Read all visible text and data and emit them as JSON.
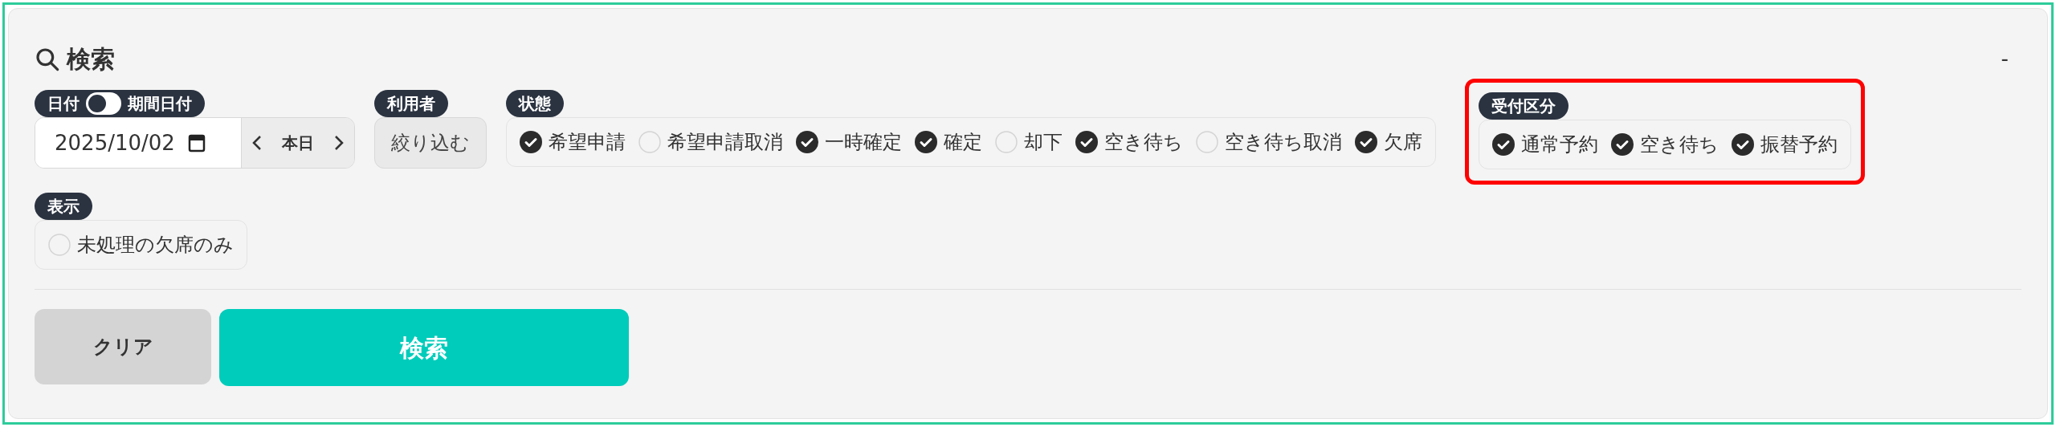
{
  "panel": {
    "title": "検索",
    "collapse": "-"
  },
  "date_filter": {
    "label": "日付",
    "toggle_label": "期間日付",
    "period": false,
    "value": "2025/10/02",
    "today": "本日"
  },
  "user_filter": {
    "label": "利用者",
    "button": "絞り込む"
  },
  "status_filter": {
    "label": "状態",
    "options": [
      {
        "label": "希望申請",
        "checked": true
      },
      {
        "label": "希望申請取消",
        "checked": false
      },
      {
        "label": "一時確定",
        "checked": true
      },
      {
        "label": "確定",
        "checked": true
      },
      {
        "label": "却下",
        "checked": false
      },
      {
        "label": "空き待ち",
        "checked": true
      },
      {
        "label": "空き待ち取消",
        "checked": false
      },
      {
        "label": "欠席",
        "checked": true
      }
    ]
  },
  "reception_filter": {
    "label": "受付区分",
    "highlighted": true,
    "options": [
      {
        "label": "通常予約",
        "checked": true
      },
      {
        "label": "空き待ち",
        "checked": true
      },
      {
        "label": "振替予約",
        "checked": true
      }
    ]
  },
  "display_filter": {
    "label": "表示",
    "options": [
      {
        "label": "未処理の欠席のみ",
        "checked": false
      }
    ]
  },
  "buttons": {
    "clear": "クリア",
    "search": "検索"
  }
}
